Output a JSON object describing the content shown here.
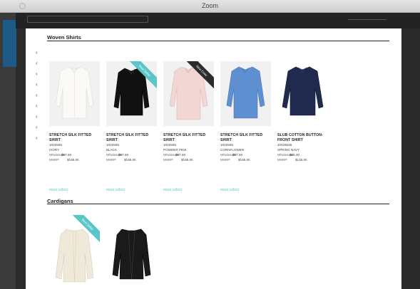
{
  "window": {
    "title": "Zoom"
  },
  "sections": {
    "woven": {
      "title": "Woven Shirts"
    },
    "cardigans": {
      "title": "Cardigans"
    }
  },
  "colors": {
    "accent_teal": "#5bc6c8",
    "ribbon_dark": "#2b2b2b",
    "page_bg": "#ffffff"
  },
  "products": [
    {
      "name_line1": "STRETCH SILK FITTED",
      "name_line2": "SHIRT",
      "style": "1002506",
      "color": "IVORY",
      "wholesale_label": "Wholesale:",
      "wholesale": "$97.50",
      "msrp_label": "MSRP:",
      "msrp": "$195.00",
      "more": "more colors",
      "ribbon": ""
    },
    {
      "name_line1": "STRETCH SILK FITTED",
      "name_line2": "SHIRT",
      "style": "1002506",
      "color": "BLACK",
      "wholesale_label": "Wholesale:",
      "wholesale": "$97.50",
      "msrp_label": "MSRP:",
      "msrp": "$195.00",
      "more": "more colors",
      "ribbon": "Best Seller"
    },
    {
      "name_line1": "STRETCH SILK FITTED",
      "name_line2": "SHIRT",
      "style": "1002506",
      "color": "POWDER PINK",
      "wholesale_label": "Wholesale:",
      "wholesale": "$97.50",
      "msrp_label": "MSRP:",
      "msrp": "$195.00",
      "more": "more colors",
      "ribbon": "New Color"
    },
    {
      "name_line1": "STRETCH SILK FITTED",
      "name_line2": "SHIRT",
      "style": "1002506",
      "color": "CORNFLOWER",
      "wholesale_label": "Wholesale:",
      "wholesale": "$97.50",
      "msrp_label": "MSRP:",
      "msrp": "$195.00",
      "more": "more colors",
      "ribbon": ""
    },
    {
      "name_line1": "SLUB COTTON BUTTON-",
      "name_line2": "FRONT SHIRT",
      "style": "J0426535",
      "color": "SPRING NAVY",
      "wholesale_label": "Wholesale:",
      "wholesale": "$65.00",
      "msrp_label": "MSRP:",
      "msrp": "$135.00",
      "more": "",
      "ribbon": ""
    }
  ],
  "cardigan_products": [
    {
      "ribbon": "Best Seller"
    },
    {
      "ribbon": ""
    }
  ]
}
